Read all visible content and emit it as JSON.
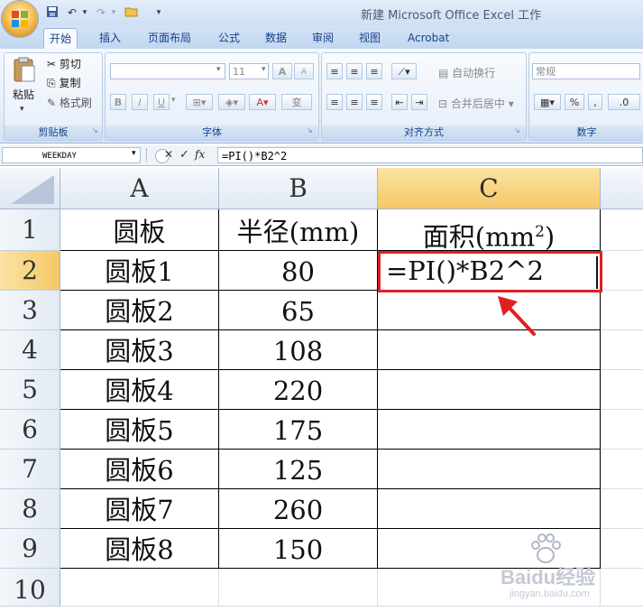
{
  "window": {
    "title": "新建 Microsoft Office Excel 工作"
  },
  "quick_access": {
    "save_icon": "save-icon",
    "undo_icon": "undo-icon",
    "redo_icon": "redo-icon",
    "open_icon": "open-folder-icon",
    "customize_icon": "customize-icon"
  },
  "ribbon": {
    "tabs": [
      "开始",
      "插入",
      "页面布局",
      "公式",
      "数据",
      "审阅",
      "视图",
      "Acrobat"
    ],
    "active_tab": "开始",
    "clipboard": {
      "label": "剪贴板",
      "paste": "粘贴",
      "cut": "剪切",
      "copy": "复制",
      "format_painter": "格式刷"
    },
    "font": {
      "label": "字体",
      "font_name": "",
      "font_size": "11",
      "bold": "B",
      "italic": "I",
      "underline": "U",
      "grow": "A",
      "shrink": "A",
      "wen": "变"
    },
    "alignment": {
      "label": "对齐方式",
      "wrap_text": "自动换行",
      "merge_center": "合并后居中"
    },
    "number": {
      "label": "数字",
      "format": "常规",
      "percent": "%"
    }
  },
  "formula_bar": {
    "name_box": "WEEKDAY",
    "cancel": "✕",
    "enter": "✓",
    "fx": "fx",
    "formula": "=PI()*B2^2"
  },
  "sheet": {
    "columns": [
      "A",
      "B",
      "C"
    ],
    "selected_column": "C",
    "rows": [
      "1",
      "2",
      "3",
      "4",
      "5",
      "6",
      "7",
      "8",
      "9",
      "10"
    ],
    "selected_row": "2",
    "header": {
      "a": "圆板",
      "b": "半径(mm)",
      "c_prefix": "面积(mm",
      "c_sup": "2",
      "c_suffix": ")"
    },
    "data": [
      {
        "name": "圆板1",
        "radius": "80"
      },
      {
        "name": "圆板2",
        "radius": "65"
      },
      {
        "name": "圆板3",
        "radius": "108"
      },
      {
        "name": "圆板4",
        "radius": "220"
      },
      {
        "name": "圆板5",
        "radius": "175"
      },
      {
        "name": "圆板6",
        "radius": "125"
      },
      {
        "name": "圆板7",
        "radius": "260"
      },
      {
        "name": "圆板8",
        "radius": "150"
      }
    ],
    "editing_cell": "=PI()*B2^2"
  },
  "watermark": {
    "text": "Baidu经验",
    "url": "jingyan.baidu.com"
  },
  "colors": {
    "selection_header": "#f5c866",
    "active_border": "#dd2222",
    "ribbon_text": "#15428b",
    "arrow": "#e02020"
  }
}
